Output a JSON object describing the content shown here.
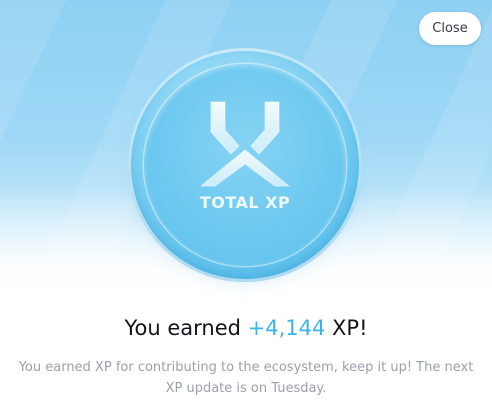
{
  "modal": {
    "close_label": "Close",
    "coin_label": "TOTAL XP",
    "headline_prefix": "You earned ",
    "headline_amount": "+4,144",
    "headline_suffix": " XP!",
    "description": "You earned XP for contributing to the ecosystem, keep it up! The next XP update is on Tuesday."
  },
  "colors": {
    "accent": "#3bb4e9",
    "hero_top": "#8ed0f3",
    "coin": "#62c4ef",
    "headline_text": "#111418",
    "description_text": "#9aa1aa"
  },
  "icons": {
    "coin_logo": "xp-logo-icon"
  }
}
